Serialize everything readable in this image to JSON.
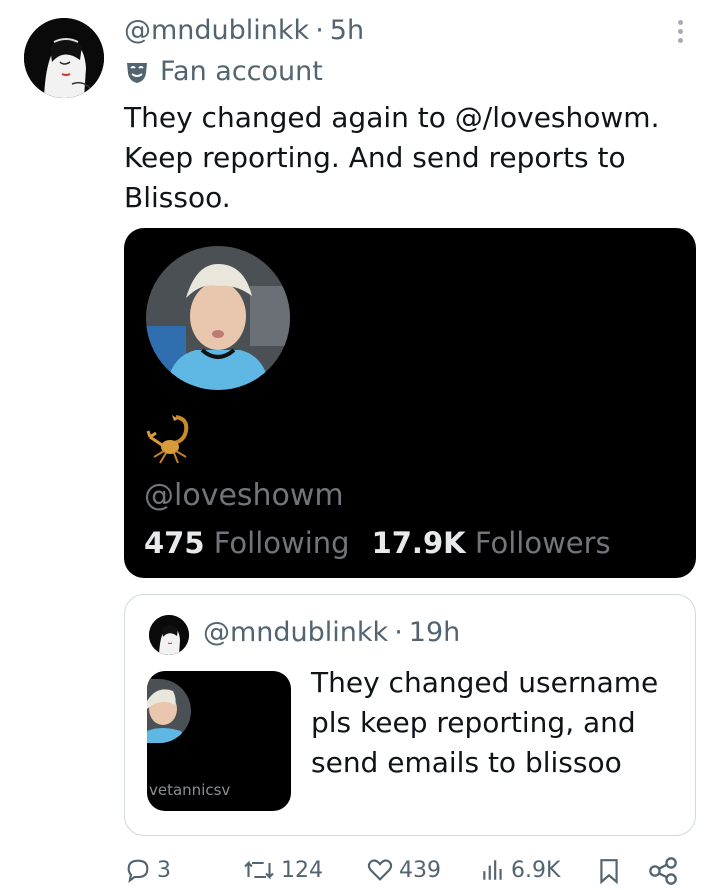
{
  "tweet": {
    "handle": "@mndublinkk",
    "separator": "·",
    "time": "5h",
    "label": "Fan account",
    "text": "They changed again to @/loveshowm.\nKeep reporting. And send reports to\nBlissoo."
  },
  "card": {
    "handle": "@loveshowm",
    "following_count": "475",
    "following_label": "Following",
    "followers_count": "17.9K",
    "followers_label": "Followers"
  },
  "quote": {
    "handle": "@mndublinkk",
    "separator": "·",
    "time": "19h",
    "thumb_text": "vetannicsv",
    "text": "They changed username\npls keep reporting, and\nsend emails to blissoo"
  },
  "actions": {
    "replies": "3",
    "reposts": "124",
    "likes": "439",
    "views": "6.9K",
    "icons": [
      "reply-icon",
      "repost-icon",
      "like-icon",
      "views-icon",
      "bookmark-icon",
      "share-icon"
    ]
  },
  "colors": {
    "text": "#0f1419",
    "secondary": "#536471",
    "card_bg": "#000000",
    "border": "#cfd9de"
  }
}
